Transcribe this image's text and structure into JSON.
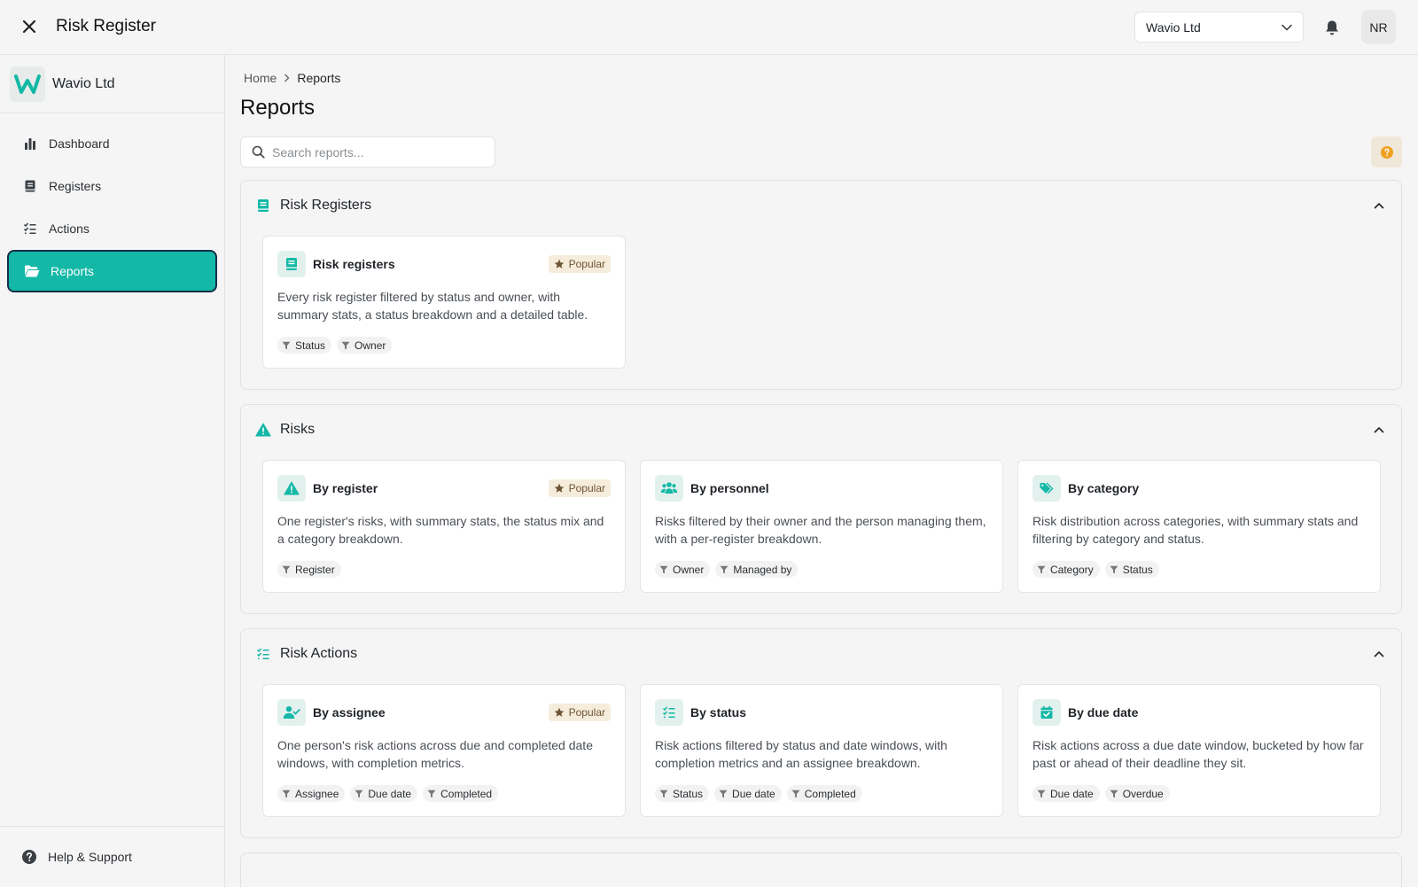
{
  "app": {
    "title": "Risk Register"
  },
  "header": {
    "org_select": "Wavio Ltd",
    "avatar_initials": "NR"
  },
  "sidebar": {
    "org_name": "Wavio Ltd",
    "items": [
      {
        "label": "Dashboard",
        "icon": "bar-chart-icon"
      },
      {
        "label": "Registers",
        "icon": "book-icon"
      },
      {
        "label": "Actions",
        "icon": "checklist-icon"
      },
      {
        "label": "Reports",
        "icon": "folder-open-icon",
        "active": true
      }
    ],
    "help_label": "Help & Support"
  },
  "main": {
    "breadcrumb": {
      "home": "Home",
      "current": "Reports"
    },
    "title": "Reports",
    "search": {
      "placeholder": "Search reports...",
      "value": ""
    },
    "sections": [
      {
        "title": "Risk Registers",
        "icon": "book-icon",
        "cards": [
          {
            "title": "Risk registers",
            "icon": "book-icon",
            "badge": "Popular",
            "description": "Every risk register filtered by status and owner, with summary stats, a status breakdown and a detailed table.",
            "filters": [
              "Status",
              "Owner"
            ]
          }
        ]
      },
      {
        "title": "Risks",
        "icon": "warning-icon",
        "cards": [
          {
            "title": "By register",
            "icon": "warning-icon",
            "badge": "Popular",
            "description": "One register's risks, with summary stats, the status mix and a category breakdown.",
            "filters": [
              "Register"
            ]
          },
          {
            "title": "By personnel",
            "icon": "people-icon",
            "description": "Risks filtered by their owner and the person managing them, with a per-register breakdown.",
            "filters": [
              "Owner",
              "Managed by"
            ]
          },
          {
            "title": "By category",
            "icon": "tag-icon",
            "description": "Risk distribution across categories, with summary stats and filtering by category and status.",
            "filters": [
              "Category",
              "Status"
            ]
          }
        ]
      },
      {
        "title": "Risk Actions",
        "icon": "checklist-icon",
        "cards": [
          {
            "title": "By assignee",
            "icon": "user-check-icon",
            "badge": "Popular",
            "description": "One person's risk actions across due and completed date windows, with completion metrics.",
            "filters": [
              "Assignee",
              "Due date",
              "Completed"
            ]
          },
          {
            "title": "By status",
            "icon": "checklist-icon",
            "description": "Risk actions filtered by status and date windows, with completion metrics and an assignee breakdown.",
            "filters": [
              "Status",
              "Due date",
              "Completed"
            ]
          },
          {
            "title": "By due date",
            "icon": "calendar-check-icon",
            "description": "Risk actions across a due date window, bucketed by how far past or ahead of their deadline they sit.",
            "filters": [
              "Due date",
              "Overdue"
            ]
          }
        ]
      }
    ]
  },
  "colors": {
    "accent": "#14b8a6",
    "accent_dark": "#0f9b8c",
    "badge_bg": "#f6ecdc",
    "active_border": "#13304a"
  }
}
